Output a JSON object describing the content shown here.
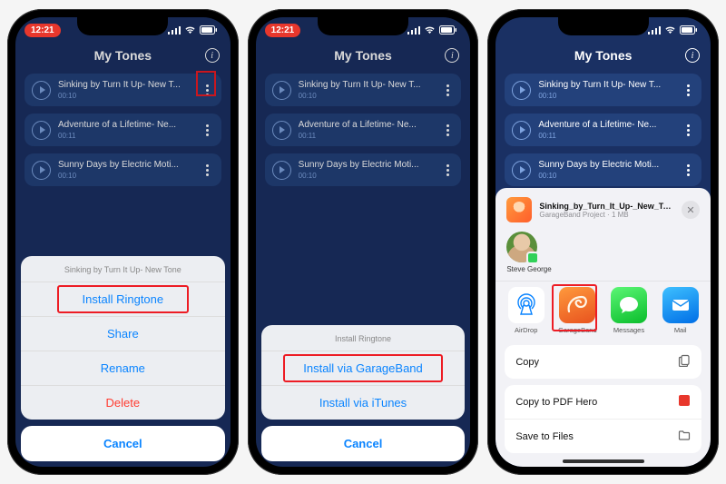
{
  "status": {
    "time": "12:21"
  },
  "header": {
    "title": "My Tones"
  },
  "tones": [
    {
      "title": "Sinking by Turn It Up- New T...",
      "duration": "00:10"
    },
    {
      "title": "Adventure of a Lifetime- Ne...",
      "duration": "00:11"
    },
    {
      "title": "Sunny Days by Electric Moti...",
      "duration": "00:10"
    }
  ],
  "sheet1": {
    "title": "Sinking by Turn It Up- New Tone",
    "install": "Install Ringtone",
    "share": "Share",
    "rename": "Rename",
    "delete": "Delete",
    "cancel": "Cancel"
  },
  "sheet2": {
    "title": "Install Ringtone",
    "gb": "Install via GarageBand",
    "itunes": "Install via iTunes",
    "cancel": "Cancel"
  },
  "share": {
    "filename": "Sinking_by_Turn_It_Up-_New_Tone",
    "filesub": "GarageBand Project · 1 MB",
    "contact_name": "Steve George",
    "apps": {
      "airdrop": "AirDrop",
      "garageband": "GarageBand",
      "messages": "Messages",
      "mail": "Mail"
    },
    "copy": "Copy",
    "copy_pdf": "Copy to PDF Hero",
    "save_files": "Save to Files"
  }
}
